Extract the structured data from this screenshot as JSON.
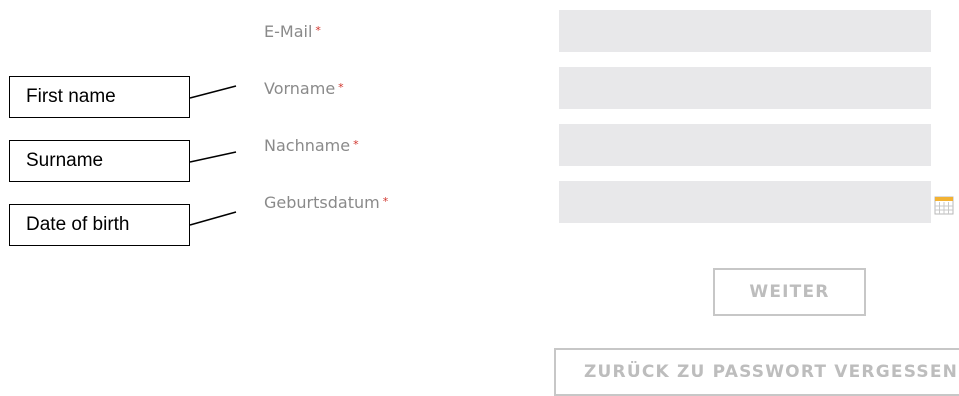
{
  "form": {
    "required_marker": "*",
    "fields": [
      {
        "label": "E-Mail",
        "value": ""
      },
      {
        "label": "Vorname",
        "value": ""
      },
      {
        "label": "Nachname",
        "value": ""
      },
      {
        "label": "Geburtsdatum",
        "value": ""
      }
    ],
    "next_button_label": "WEITER",
    "back_button_label": "ZURÜCK ZU PASSWORT VERGESSEN"
  },
  "annotations": [
    {
      "text": "First name"
    },
    {
      "text": "Surname"
    },
    {
      "text": "Date of birth"
    }
  ],
  "colors": {
    "label_text": "#8a8a8a",
    "required_marker": "#d0342c",
    "input_background": "#e8e8ea",
    "button_border": "#c7c7c7",
    "button_text": "#bdbdbd"
  },
  "icons": {
    "date_picker": "calendar-icon"
  }
}
